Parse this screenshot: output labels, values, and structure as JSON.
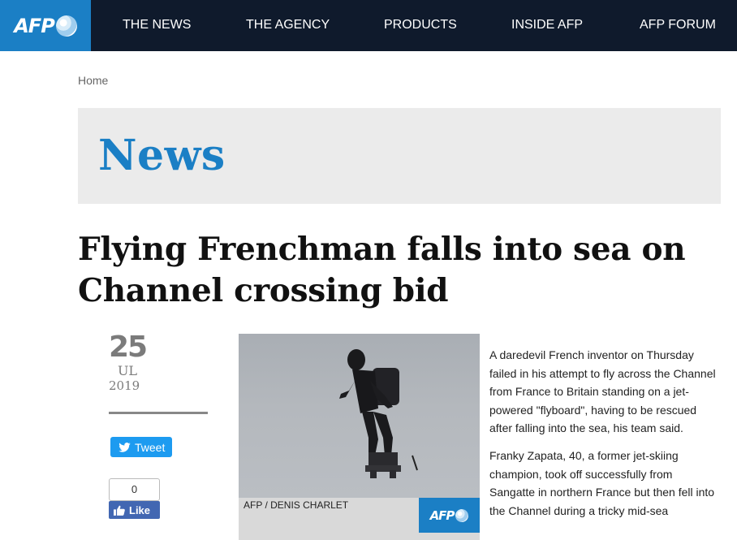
{
  "brand": {
    "logo_text": "AFP",
    "logo_bg": "#1b7fc5",
    "nav_bg": "#0f1a2c"
  },
  "nav": {
    "items": [
      "THE NEWS",
      "THE AGENCY",
      "PRODUCTS",
      "INSIDE AFP",
      "AFP FORUM"
    ]
  },
  "breadcrumb": {
    "home": "Home"
  },
  "section": {
    "title": "News"
  },
  "article": {
    "headline": "Flying Frenchman falls into sea on Channel crossing bid",
    "date": {
      "day": "25",
      "month": "UL",
      "year": "2019"
    },
    "photo_credit": "AFP / DENIS CHARLET",
    "paragraphs": [
      "A daredevil French inventor on Thursday failed in his attempt to fly across the Channel from France to Britain standing on a jet-powered \"flyboard\", having to be rescued after falling into the sea, his team said.",
      "Franky Zapata, 40, a former jet-skiing champion, took off successfully from Sangatte in northern France but then fell into the Channel during a tricky mid-sea"
    ]
  },
  "share": {
    "tweet_label": "Tweet",
    "like_count": "0",
    "like_label": "Like"
  },
  "icons": {
    "twitter": "twitter-bird-icon",
    "like": "thumbs-up-icon",
    "globe": "afp-globe-icon"
  }
}
